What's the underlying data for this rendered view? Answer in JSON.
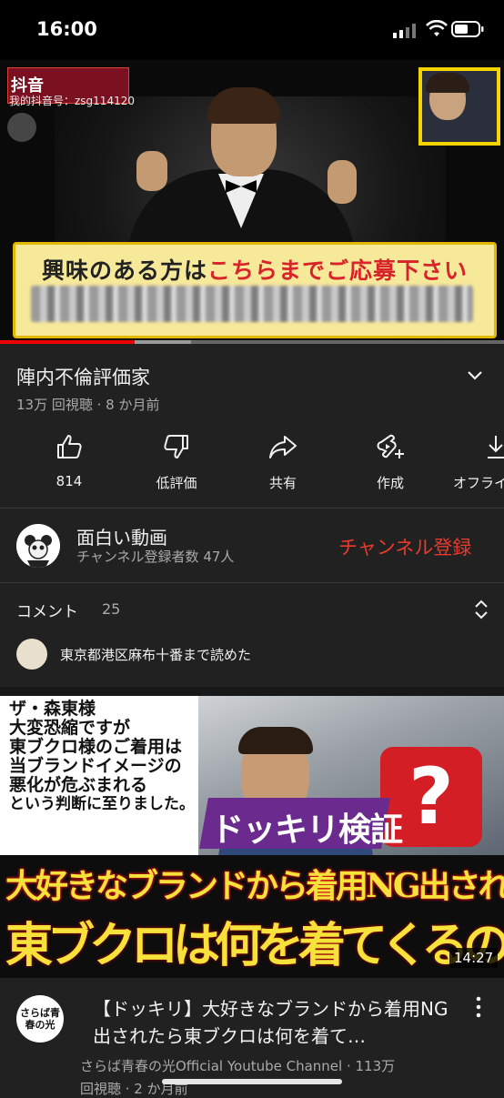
{
  "status_bar": {
    "time": "16:00"
  },
  "player": {
    "watermark_logo": "抖音",
    "watermark_id": "我的抖音号：zsg114120",
    "caption_prefix": "興味のある方は",
    "caption_highlight": "こちらまでご応募下さい",
    "progress_played": 0.267,
    "progress_buffered": 0.379
  },
  "video": {
    "title": "陣内不倫評価家",
    "meta": "13万 回視聴 · 8 か月前"
  },
  "actions": [
    {
      "label": "814",
      "icon": "thumb-up-icon"
    },
    {
      "label": "低評価",
      "icon": "thumb-down-icon"
    },
    {
      "label": "共有",
      "icon": "share-icon"
    },
    {
      "label": "作成",
      "icon": "create-icon"
    },
    {
      "label": "オフライ",
      "icon": "download-icon"
    }
  ],
  "channel": {
    "name": "面白い動画",
    "subscribers": "チャンネル登録者数 47人",
    "subscribe_label": "チャンネル登録"
  },
  "comments": {
    "label": "コメント",
    "count": "25",
    "preview": "東京都港区麻布十番まで読めた"
  },
  "next_video": {
    "thumb_left_title": "ザ・森東様",
    "thumb_left_lines": [
      "大変恐縮ですが",
      "東ブクロ様のご着用は",
      "当ブランドイメージの",
      "悪化が危ぶまれる",
      "という判断に至りました。"
    ],
    "thumb_badge": "ドッキリ検証",
    "thumb_question": "?",
    "thumb_line1": "大好きなブランドから着用NG出されたら",
    "thumb_line2": "東ブクロは何を着てくるのか?",
    "duration": "14:27",
    "title": "【ドッキリ】大好きなブランドから着用NG出されたら東ブクロは何を着て…",
    "channel_avatar_text": "さらば青春の光",
    "meta": "さらば青春の光Official Youtube Channel · 113万",
    "meta_line2": "回視聴 · 2 か月前"
  },
  "colors": {
    "background": "#212121",
    "accent_red": "#e63b2e",
    "progress_red": "#ee0000"
  }
}
